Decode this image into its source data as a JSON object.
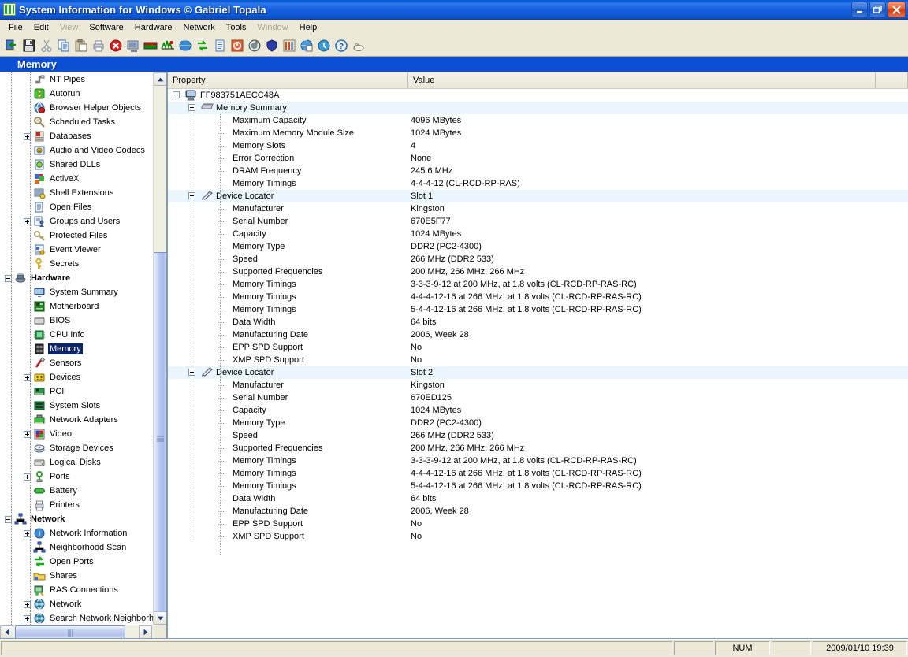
{
  "window": {
    "title": "System Information for Windows  © Gabriel Topala",
    "app_icon": "siw-logo-icon",
    "minimize_label": "Minimize",
    "maximize_label": "Maximize",
    "close_label": "Close"
  },
  "menu": [
    {
      "label": "File",
      "disabled": false
    },
    {
      "label": "Edit",
      "disabled": false
    },
    {
      "label": "View",
      "disabled": true
    },
    {
      "label": "Software",
      "disabled": false
    },
    {
      "label": "Hardware",
      "disabled": false
    },
    {
      "label": "Network",
      "disabled": false
    },
    {
      "label": "Tools",
      "disabled": false
    },
    {
      "label": "Window",
      "disabled": true
    },
    {
      "label": "Help",
      "disabled": false
    }
  ],
  "toolbar": {
    "buttons": [
      {
        "name": "exit-icon",
        "title": "Exit"
      },
      {
        "name": "save-icon",
        "title": "Save"
      },
      {
        "name": "cut-icon",
        "title": "Cut"
      },
      {
        "name": "copy-icon",
        "title": "Copy"
      },
      {
        "name": "paste-icon",
        "title": "Paste"
      },
      {
        "name": "print-icon",
        "title": "Print"
      },
      {
        "name": "delete-icon",
        "title": "Delete"
      },
      {
        "name": "screenshot-icon",
        "title": "Screen Capture"
      },
      {
        "name": "color-bar-icon",
        "title": "Benchmark"
      },
      {
        "name": "monitor-test-icon",
        "title": "Monitor Test"
      },
      {
        "name": "internet-icon",
        "title": "Internet"
      },
      {
        "name": "refresh-icon",
        "title": "Refresh"
      },
      {
        "name": "report-icon",
        "title": "Report"
      },
      {
        "name": "shutdown-icon",
        "title": "Shutdown"
      },
      {
        "name": "eject-icon",
        "title": "Eject"
      },
      {
        "name": "shield-icon",
        "title": "Security"
      },
      {
        "name": "tools-icon",
        "title": "Tools"
      },
      {
        "name": "world-info-icon",
        "title": "Network Info"
      },
      {
        "name": "update-icon",
        "title": "Check for Updates"
      },
      {
        "name": "help-icon",
        "title": "Help"
      },
      {
        "name": "about-icon",
        "title": "About"
      }
    ]
  },
  "section": {
    "title": "Memory"
  },
  "tree": {
    "items": [
      {
        "label": "NT Pipes",
        "indent": 2,
        "expander": "none",
        "icon": "pipe-icon",
        "bold": false,
        "selected": false
      },
      {
        "label": "Autorun",
        "indent": 2,
        "expander": "none",
        "icon": "autorun-icon",
        "bold": false,
        "selected": false
      },
      {
        "label": "Browser Helper Objects",
        "indent": 2,
        "expander": "none",
        "icon": "bho-icon",
        "bold": false,
        "selected": false
      },
      {
        "label": "Scheduled Tasks",
        "indent": 2,
        "expander": "none",
        "icon": "scheduled-tasks-icon",
        "bold": false,
        "selected": false
      },
      {
        "label": "Databases",
        "indent": 2,
        "expander": "plus",
        "icon": "databases-icon",
        "bold": false,
        "selected": false
      },
      {
        "label": "Audio and Video Codecs",
        "indent": 2,
        "expander": "none",
        "icon": "codecs-icon",
        "bold": false,
        "selected": false
      },
      {
        "label": "Shared DLLs",
        "indent": 2,
        "expander": "none",
        "icon": "shared-dlls-icon",
        "bold": false,
        "selected": false
      },
      {
        "label": "ActiveX",
        "indent": 2,
        "expander": "none",
        "icon": "activex-icon",
        "bold": false,
        "selected": false
      },
      {
        "label": "Shell Extensions",
        "indent": 2,
        "expander": "none",
        "icon": "shell-ext-icon",
        "bold": false,
        "selected": false
      },
      {
        "label": "Open Files",
        "indent": 2,
        "expander": "none",
        "icon": "open-files-icon",
        "bold": false,
        "selected": false
      },
      {
        "label": "Groups and Users",
        "indent": 2,
        "expander": "plus",
        "icon": "groups-users-icon",
        "bold": false,
        "selected": false
      },
      {
        "label": "Protected Files",
        "indent": 2,
        "expander": "none",
        "icon": "protected-files-icon",
        "bold": false,
        "selected": false
      },
      {
        "label": "Event Viewer",
        "indent": 2,
        "expander": "none",
        "icon": "event-viewer-icon",
        "bold": false,
        "selected": false
      },
      {
        "label": "Secrets",
        "indent": 2,
        "expander": "none",
        "icon": "secrets-key-icon",
        "bold": false,
        "selected": false
      },
      {
        "label": "Hardware",
        "indent": 1,
        "expander": "minus",
        "icon": "hardware-icon",
        "bold": true,
        "selected": false
      },
      {
        "label": "System Summary",
        "indent": 2,
        "expander": "none",
        "icon": "system-summary-icon",
        "bold": false,
        "selected": false
      },
      {
        "label": "Motherboard",
        "indent": 2,
        "expander": "none",
        "icon": "motherboard-icon",
        "bold": false,
        "selected": false
      },
      {
        "label": "BIOS",
        "indent": 2,
        "expander": "none",
        "icon": "bios-icon",
        "bold": false,
        "selected": false
      },
      {
        "label": "CPU Info",
        "indent": 2,
        "expander": "none",
        "icon": "cpu-icon",
        "bold": false,
        "selected": false
      },
      {
        "label": "Memory",
        "indent": 2,
        "expander": "none",
        "icon": "memory-icon",
        "bold": false,
        "selected": true
      },
      {
        "label": "Sensors",
        "indent": 2,
        "expander": "none",
        "icon": "sensors-icon",
        "bold": false,
        "selected": false
      },
      {
        "label": "Devices",
        "indent": 2,
        "expander": "plus",
        "icon": "devices-icon",
        "bold": false,
        "selected": false
      },
      {
        "label": "PCI",
        "indent": 2,
        "expander": "none",
        "icon": "pci-icon",
        "bold": false,
        "selected": false
      },
      {
        "label": "System Slots",
        "indent": 2,
        "expander": "none",
        "icon": "system-slots-icon",
        "bold": false,
        "selected": false
      },
      {
        "label": "Network Adapters",
        "indent": 2,
        "expander": "none",
        "icon": "network-adapter-icon",
        "bold": false,
        "selected": false
      },
      {
        "label": "Video",
        "indent": 2,
        "expander": "plus",
        "icon": "video-icon",
        "bold": false,
        "selected": false
      },
      {
        "label": "Storage Devices",
        "indent": 2,
        "expander": "none",
        "icon": "storage-icon",
        "bold": false,
        "selected": false
      },
      {
        "label": "Logical Disks",
        "indent": 2,
        "expander": "none",
        "icon": "logical-disks-icon",
        "bold": false,
        "selected": false
      },
      {
        "label": "Ports",
        "indent": 2,
        "expander": "plus",
        "icon": "ports-icon",
        "bold": false,
        "selected": false
      },
      {
        "label": "Battery",
        "indent": 2,
        "expander": "none",
        "icon": "battery-icon",
        "bold": false,
        "selected": false
      },
      {
        "label": "Printers",
        "indent": 2,
        "expander": "none",
        "icon": "printer-icon",
        "bold": false,
        "selected": false
      },
      {
        "label": "Network",
        "indent": 1,
        "expander": "minus",
        "icon": "network-group-icon",
        "bold": true,
        "selected": false
      },
      {
        "label": "Network Information",
        "indent": 2,
        "expander": "plus",
        "icon": "net-info-icon",
        "bold": false,
        "selected": false
      },
      {
        "label": "Neighborhood Scan",
        "indent": 2,
        "expander": "none",
        "icon": "neighborhood-icon",
        "bold": false,
        "selected": false
      },
      {
        "label": "Open Ports",
        "indent": 2,
        "expander": "none",
        "icon": "open-ports-icon",
        "bold": false,
        "selected": false
      },
      {
        "label": "Shares",
        "indent": 2,
        "expander": "none",
        "icon": "shares-icon",
        "bold": false,
        "selected": false
      },
      {
        "label": "RAS Connections",
        "indent": 2,
        "expander": "none",
        "icon": "ras-icon",
        "bold": false,
        "selected": false
      },
      {
        "label": "Network",
        "indent": 2,
        "expander": "plus",
        "icon": "globe-icon",
        "bold": false,
        "selected": false
      },
      {
        "label": "Search Network Neighborh",
        "indent": 2,
        "expander": "plus",
        "icon": "globe-icon",
        "bold": false,
        "selected": false
      }
    ]
  },
  "list": {
    "columns": [
      {
        "label": "Property"
      },
      {
        "label": "Value"
      },
      {
        "label": ""
      }
    ],
    "rows": [
      {
        "prop": "FF983751AECC48A",
        "value": "",
        "level": 0,
        "expander": "minus",
        "icon": "computer-icon",
        "group": false
      },
      {
        "prop": "Memory Summary",
        "value": "",
        "level": 1,
        "expander": "minus",
        "icon": "memory-module-icon",
        "group": true
      },
      {
        "prop": "Maximum Capacity",
        "value": "4096 MBytes",
        "level": 2,
        "expander": "none",
        "icon": "",
        "group": false
      },
      {
        "prop": "Maximum Memory Module Size",
        "value": "1024 MBytes",
        "level": 2,
        "expander": "none",
        "icon": "",
        "group": false
      },
      {
        "prop": "Memory Slots",
        "value": "4",
        "level": 2,
        "expander": "none",
        "icon": "",
        "group": false
      },
      {
        "prop": "Error Correction",
        "value": "None",
        "level": 2,
        "expander": "none",
        "icon": "",
        "group": false
      },
      {
        "prop": "DRAM Frequency",
        "value": "245.6 MHz",
        "level": 2,
        "expander": "none",
        "icon": "",
        "group": false
      },
      {
        "prop": "Memory Timings",
        "value": "4-4-4-12 (CL-RCD-RP-RAS)",
        "level": 2,
        "expander": "none",
        "icon": "",
        "group": false
      },
      {
        "prop": "Device Locator",
        "value": "Slot 1",
        "level": 1,
        "expander": "minus",
        "icon": "memory-stick-icon",
        "group": true
      },
      {
        "prop": "Manufacturer",
        "value": "Kingston",
        "level": 2,
        "expander": "none",
        "icon": "",
        "group": false
      },
      {
        "prop": "Serial Number",
        "value": "670E5F77",
        "level": 2,
        "expander": "none",
        "icon": "",
        "group": false
      },
      {
        "prop": "Capacity",
        "value": "1024 MBytes",
        "level": 2,
        "expander": "none",
        "icon": "",
        "group": false
      },
      {
        "prop": "Memory Type",
        "value": "DDR2 (PC2-4300)",
        "level": 2,
        "expander": "none",
        "icon": "",
        "group": false
      },
      {
        "prop": "Speed",
        "value": "266 MHz (DDR2 533)",
        "level": 2,
        "expander": "none",
        "icon": "",
        "group": false
      },
      {
        "prop": "Supported Frequencies",
        "value": "200 MHz, 266 MHz, 266 MHz",
        "level": 2,
        "expander": "none",
        "icon": "",
        "group": false
      },
      {
        "prop": "Memory Timings",
        "value": "3-3-3-9-12 at 200 MHz, at 1.8 volts (CL-RCD-RP-RAS-RC)",
        "level": 2,
        "expander": "none",
        "icon": "",
        "group": false
      },
      {
        "prop": "Memory Timings",
        "value": "4-4-4-12-16 at 266 MHz, at 1.8 volts (CL-RCD-RP-RAS-RC)",
        "level": 2,
        "expander": "none",
        "icon": "",
        "group": false
      },
      {
        "prop": "Memory Timings",
        "value": "5-4-4-12-16 at 266 MHz, at 1.8 volts (CL-RCD-RP-RAS-RC)",
        "level": 2,
        "expander": "none",
        "icon": "",
        "group": false
      },
      {
        "prop": "Data Width",
        "value": "64 bits",
        "level": 2,
        "expander": "none",
        "icon": "",
        "group": false
      },
      {
        "prop": "Manufacturing Date",
        "value": "2006, Week 28",
        "level": 2,
        "expander": "none",
        "icon": "",
        "group": false
      },
      {
        "prop": "EPP SPD Support",
        "value": "No",
        "level": 2,
        "expander": "none",
        "icon": "",
        "group": false
      },
      {
        "prop": "XMP SPD Support",
        "value": "No",
        "level": 2,
        "expander": "none",
        "icon": "",
        "group": false
      },
      {
        "prop": "Device Locator",
        "value": "Slot 2",
        "level": 1,
        "expander": "minus",
        "icon": "memory-stick-icon",
        "group": true
      },
      {
        "prop": "Manufacturer",
        "value": "Kingston",
        "level": 2,
        "expander": "none",
        "icon": "",
        "group": false
      },
      {
        "prop": "Serial Number",
        "value": "670ED125",
        "level": 2,
        "expander": "none",
        "icon": "",
        "group": false
      },
      {
        "prop": "Capacity",
        "value": "1024 MBytes",
        "level": 2,
        "expander": "none",
        "icon": "",
        "group": false
      },
      {
        "prop": "Memory Type",
        "value": "DDR2 (PC2-4300)",
        "level": 2,
        "expander": "none",
        "icon": "",
        "group": false
      },
      {
        "prop": "Speed",
        "value": "266 MHz (DDR2 533)",
        "level": 2,
        "expander": "none",
        "icon": "",
        "group": false
      },
      {
        "prop": "Supported Frequencies",
        "value": "200 MHz, 266 MHz, 266 MHz",
        "level": 2,
        "expander": "none",
        "icon": "",
        "group": false
      },
      {
        "prop": "Memory Timings",
        "value": "3-3-3-9-12 at 200 MHz, at 1.8 volts (CL-RCD-RP-RAS-RC)",
        "level": 2,
        "expander": "none",
        "icon": "",
        "group": false
      },
      {
        "prop": "Memory Timings",
        "value": "4-4-4-12-16 at 266 MHz, at 1.8 volts (CL-RCD-RP-RAS-RC)",
        "level": 2,
        "expander": "none",
        "icon": "",
        "group": false
      },
      {
        "prop": "Memory Timings",
        "value": "5-4-4-12-16 at 266 MHz, at 1.8 volts (CL-RCD-RP-RAS-RC)",
        "level": 2,
        "expander": "none",
        "icon": "",
        "group": false
      },
      {
        "prop": "Data Width",
        "value": "64 bits",
        "level": 2,
        "expander": "none",
        "icon": "",
        "group": false
      },
      {
        "prop": "Manufacturing Date",
        "value": "2006, Week 28",
        "level": 2,
        "expander": "none",
        "icon": "",
        "group": false
      },
      {
        "prop": "EPP SPD Support",
        "value": "No",
        "level": 2,
        "expander": "none",
        "icon": "",
        "group": false
      },
      {
        "prop": "XMP SPD Support",
        "value": "No",
        "level": 2,
        "expander": "none",
        "icon": "",
        "group": false
      }
    ]
  },
  "statusbar": {
    "message": "",
    "num": "NUM",
    "caps": "",
    "ins": "",
    "datetime": "2009/01/10 19:39"
  },
  "colors": {
    "titlebar_blue": "#1661e0",
    "section_blue": "#0b4fd6",
    "selection_navy": "#0a246a",
    "group_row": "#ebf5fd",
    "chrome": "#ece9d8"
  }
}
